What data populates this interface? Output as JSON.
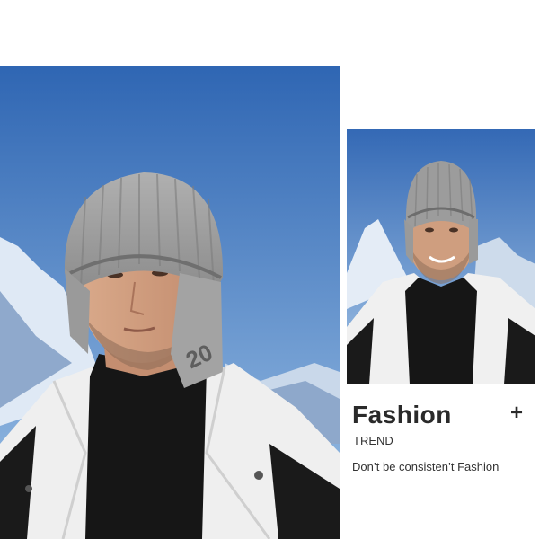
{
  "caption": {
    "title": "Fashion",
    "plus": "+",
    "subtitle": "TREND",
    "slogan": "Don’t be consisten’t Fashion"
  },
  "photos": {
    "main": {
      "subject": "man wearing grey ribbed knit beanie with ear flaps, white and black winter jacket, black turtleneck, snowy mountains and blue sky"
    },
    "side": {
      "subject": "smiling man wearing the same grey knit ear-flap beanie and white and black jacket against snowy mountains"
    }
  },
  "colors": {
    "sky_top": "#2f66b3",
    "sky_bottom": "#9cc1e6",
    "hat": "#9a9a9a",
    "jacket": "#f2f2f2",
    "text": "#2a2a2a"
  }
}
